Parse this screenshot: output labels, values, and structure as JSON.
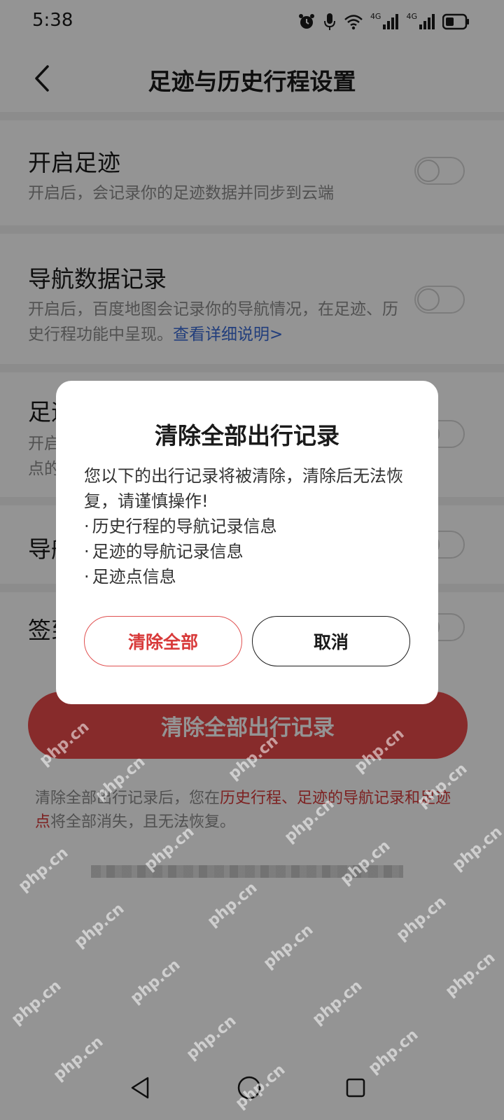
{
  "status_bar": {
    "time": "5:38",
    "network_labels": [
      "4G",
      "4G"
    ],
    "icons": [
      "alarm-icon",
      "mic-icon",
      "wifi-icon",
      "signal-icon",
      "signal-icon",
      "battery-icon"
    ]
  },
  "header": {
    "title": "足迹与历史行程设置",
    "back_icon": "chevron-left-icon"
  },
  "settings": [
    {
      "title": "开启足迹",
      "desc": "开启后，会记录你的足迹数据并同步到云端",
      "link": "",
      "enabled": false
    },
    {
      "title": "导航数据记录",
      "desc": "开启后，百度地图会记录你的导航情况，在足迹、历史行程功能中呈现。",
      "link": "查看详细说明>",
      "enabled": false
    },
    {
      "title": "足迹",
      "desc": "开启\n点的",
      "link": "",
      "enabled": false
    },
    {
      "title": "导航",
      "desc": "",
      "link": "",
      "enabled": false
    },
    {
      "title": "签到",
      "desc": "",
      "link": "",
      "enabled": false
    }
  ],
  "clear_all_button": "清除全部出行记录",
  "footer_note": {
    "prefix": "清除全部出行记录后，您在",
    "highlight": "历史行程、足迹的导航记录和足迹点",
    "suffix": "将全部消失，且无法恢复。"
  },
  "dialog": {
    "title": "清除全部出行记录",
    "message": "您以下的出行记录将被清除，清除后无法恢复，请谨慎操作!",
    "items": [
      "历史行程的导航记录信息",
      "足迹的导航记录信息",
      "足迹点信息"
    ],
    "confirm_label": "清除全部",
    "cancel_label": "取消"
  },
  "nav": {
    "icons": [
      "back-triangle-icon",
      "home-circle-icon",
      "recents-square-icon"
    ]
  },
  "watermark": "php.cn",
  "colors": {
    "accent_red": "#e84a4a",
    "link_blue": "#3c6bd6",
    "overlay": "rgba(0,0,0,0.42)"
  }
}
